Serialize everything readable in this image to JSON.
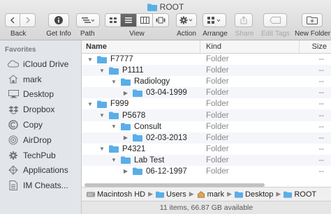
{
  "window": {
    "title": "ROOT"
  },
  "toolbar": {
    "back_label": "Back",
    "getinfo_label": "Get Info",
    "path_label": "Path",
    "view_label": "View",
    "action_label": "Action",
    "arrange_label": "Arrange",
    "share_label": "Share",
    "edittags_label": "Edit Tags",
    "newfolder_label": "New Folder"
  },
  "sidebar": {
    "heading": "Favorites",
    "items": [
      {
        "label": "iCloud Drive",
        "icon": "cloud-icon"
      },
      {
        "label": "mark",
        "icon": "home-icon"
      },
      {
        "label": "Desktop",
        "icon": "desktop-icon"
      },
      {
        "label": "Dropbox",
        "icon": "dropbox-icon"
      },
      {
        "label": "Copy",
        "icon": "copy-icon"
      },
      {
        "label": "AirDrop",
        "icon": "airdrop-icon"
      },
      {
        "label": "TechPub",
        "icon": "folder-icon"
      },
      {
        "label": "Applications",
        "icon": "applications-icon"
      },
      {
        "label": "IM Cheats...",
        "icon": "folder-icon"
      }
    ]
  },
  "columns": {
    "name": "Name",
    "kind": "Kind",
    "size": "Size"
  },
  "rows": [
    {
      "name": "F7777",
      "kind": "Folder",
      "size": "--",
      "level": 0,
      "expanded": true
    },
    {
      "name": "P1111",
      "kind": "Folder",
      "size": "--",
      "level": 1,
      "expanded": true
    },
    {
      "name": "Radiology",
      "kind": "Folder",
      "size": "--",
      "level": 2,
      "expanded": true
    },
    {
      "name": "03-04-1999",
      "kind": "Folder",
      "size": "--",
      "level": 3,
      "expanded": false
    },
    {
      "name": "F999",
      "kind": "Folder",
      "size": "--",
      "level": 0,
      "expanded": true
    },
    {
      "name": "P5678",
      "kind": "Folder",
      "size": "--",
      "level": 1,
      "expanded": true
    },
    {
      "name": "Consult",
      "kind": "Folder",
      "size": "--",
      "level": 2,
      "expanded": true
    },
    {
      "name": "02-03-2013",
      "kind": "Folder",
      "size": "--",
      "level": 3,
      "expanded": false
    },
    {
      "name": "P4321",
      "kind": "Folder",
      "size": "--",
      "level": 1,
      "expanded": true
    },
    {
      "name": "Lab Test",
      "kind": "Folder",
      "size": "--",
      "level": 2,
      "expanded": true
    },
    {
      "name": "06-12-1997",
      "kind": "Folder",
      "size": "--",
      "level": 3,
      "expanded": false
    }
  ],
  "pathbar": [
    "Macintosh HD",
    "Users",
    "mark",
    "Desktop",
    "ROOT"
  ],
  "status": "11 items, 66.87 GB available",
  "colors": {
    "folder": "#5aaee8",
    "accent": "#3b82f6"
  }
}
